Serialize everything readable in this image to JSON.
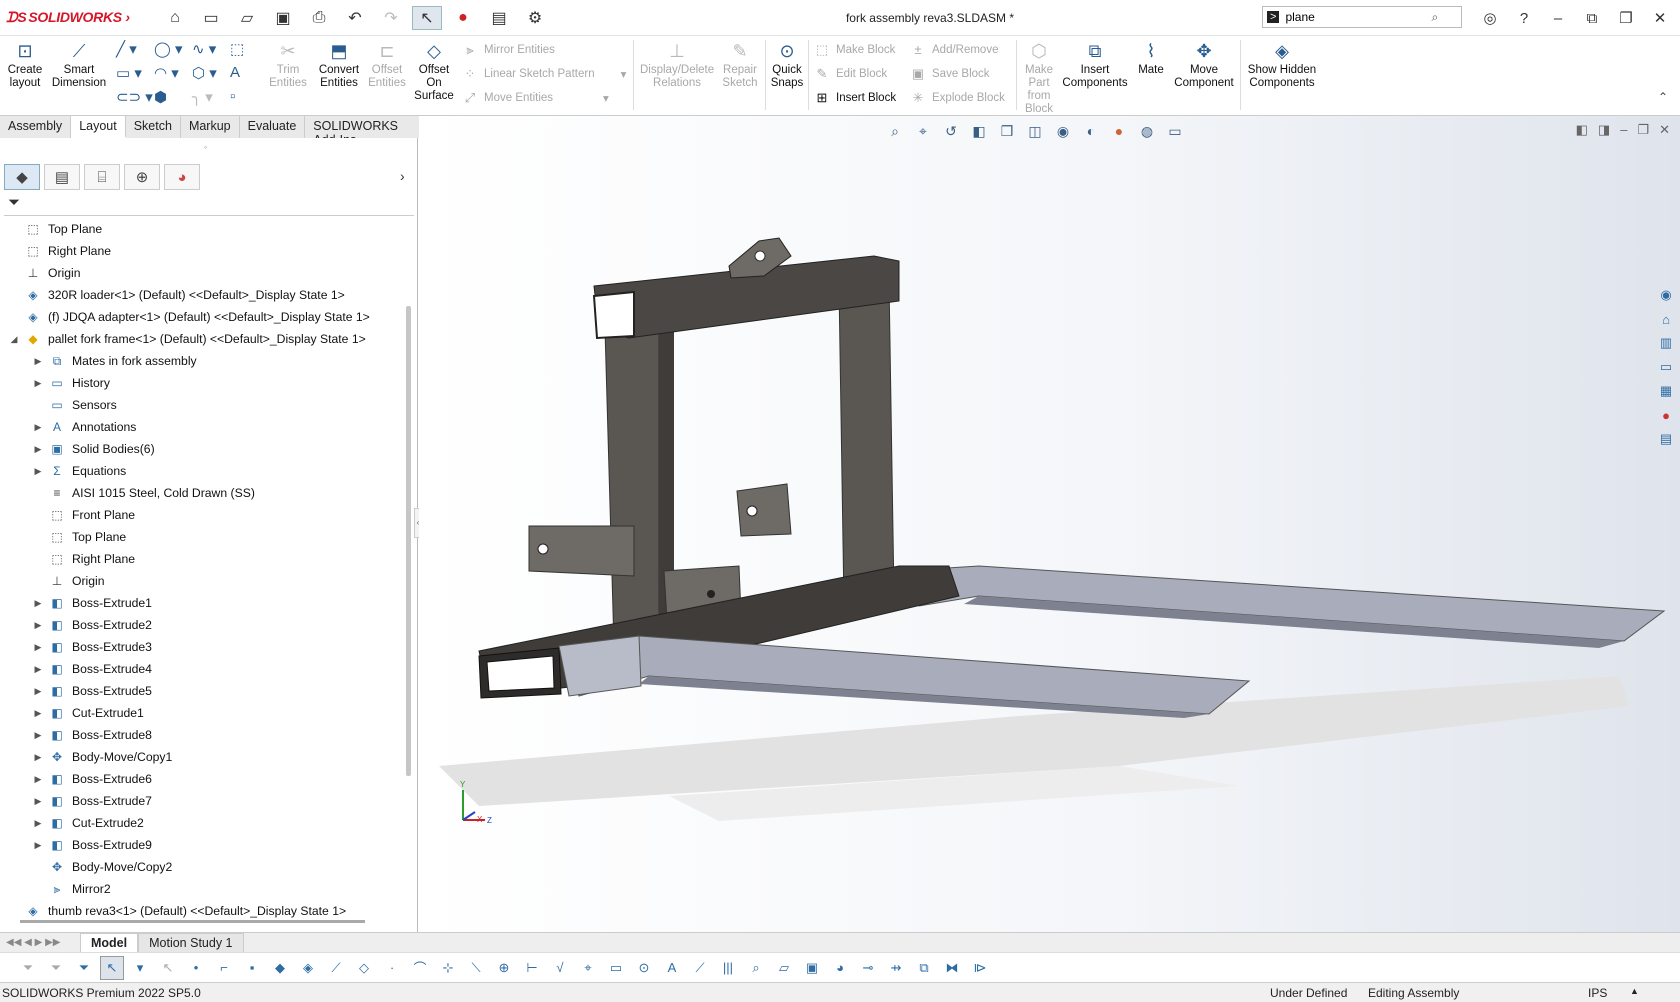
{
  "app": {
    "logo": "SOLIDWORKS",
    "document_title": "fork assembly reva3.SLDASM *"
  },
  "search": {
    "value": "plane"
  },
  "ribbon": {
    "create_layout": "Create layout",
    "smart_dimension": "Smart Dimension",
    "trim_entities": "Trim Entities",
    "convert_entities": "Convert Entities",
    "offset_entities": "Offset Entities",
    "offset_on_surface": "Offset On Surface",
    "mirror_entities": "Mirror Entities",
    "linear_sketch_pattern": "Linear Sketch Pattern",
    "move_entities": "Move Entities",
    "display_delete_relations": "Display/Delete Relations",
    "repair_sketch": "Repair Sketch",
    "quick_snaps": "Quick Snaps",
    "make_block": "Make Block",
    "edit_block": "Edit Block",
    "insert_block": "Insert Block",
    "add_remove": "Add/Remove",
    "save_block": "Save Block",
    "explode_block": "Explode Block",
    "make_part_from_block": "Make Part from Block",
    "insert_components": "Insert Components",
    "mate": "Mate",
    "move_component": "Move Component",
    "show_hidden_components": "Show Hidden Components"
  },
  "tabs": [
    "Assembly",
    "Layout",
    "Sketch",
    "Markup",
    "Evaluate",
    "SOLIDWORKS Add-Ins"
  ],
  "tree": [
    {
      "label": "Top Plane",
      "icon": "plane-icon",
      "level": 0,
      "arrow": ""
    },
    {
      "label": "Right Plane",
      "icon": "plane-icon",
      "level": 0,
      "arrow": ""
    },
    {
      "label": "Origin",
      "icon": "origin-icon",
      "level": 0,
      "arrow": ""
    },
    {
      "label": "320R loader<1> (Default) <<Default>_Display State 1>",
      "icon": "part-icon",
      "level": 0,
      "arrow": ""
    },
    {
      "label": "(f) JDQA adapter<1> (Default) <<Default>_Display State 1>",
      "icon": "part-icon",
      "level": 0,
      "arrow": ""
    },
    {
      "label": "pallet fork frame<1> (Default) <<Default>_Display State 1>",
      "icon": "part-yellow-icon",
      "level": 0,
      "arrow": "open"
    },
    {
      "label": "Mates in fork assembly",
      "icon": "mates-folder-icon",
      "level": 1,
      "arrow": "closed"
    },
    {
      "label": "History",
      "icon": "history-folder-icon",
      "level": 1,
      "arrow": "closed"
    },
    {
      "label": "Sensors",
      "icon": "sensors-folder-icon",
      "level": 1,
      "arrow": ""
    },
    {
      "label": "Annotations",
      "icon": "annotations-icon",
      "level": 1,
      "arrow": "closed"
    },
    {
      "label": "Solid Bodies(6)",
      "icon": "solid-bodies-icon",
      "level": 1,
      "arrow": "closed"
    },
    {
      "label": "Equations",
      "icon": "equations-icon",
      "level": 1,
      "arrow": "closed"
    },
    {
      "label": "AISI 1015 Steel, Cold Drawn (SS)",
      "icon": "material-icon",
      "level": 1,
      "arrow": ""
    },
    {
      "label": "Front Plane",
      "icon": "plane-icon",
      "level": 1,
      "arrow": ""
    },
    {
      "label": "Top Plane",
      "icon": "plane-icon",
      "level": 1,
      "arrow": ""
    },
    {
      "label": "Right Plane",
      "icon": "plane-icon",
      "level": 1,
      "arrow": ""
    },
    {
      "label": "Origin",
      "icon": "origin-icon",
      "level": 1,
      "arrow": ""
    },
    {
      "label": "Boss-Extrude1",
      "icon": "extrude-icon",
      "level": 1,
      "arrow": "closed"
    },
    {
      "label": "Boss-Extrude2",
      "icon": "extrude-icon",
      "level": 1,
      "arrow": "closed"
    },
    {
      "label": "Boss-Extrude3",
      "icon": "extrude-icon",
      "level": 1,
      "arrow": "closed"
    },
    {
      "label": "Boss-Extrude4",
      "icon": "extrude-icon",
      "level": 1,
      "arrow": "closed"
    },
    {
      "label": "Boss-Extrude5",
      "icon": "extrude-icon",
      "level": 1,
      "arrow": "closed"
    },
    {
      "label": "Cut-Extrude1",
      "icon": "extrude-icon",
      "level": 1,
      "arrow": "closed"
    },
    {
      "label": "Boss-Extrude8",
      "icon": "extrude-icon",
      "level": 1,
      "arrow": "closed"
    },
    {
      "label": "Body-Move/Copy1",
      "icon": "move-copy-icon",
      "level": 1,
      "arrow": "closed"
    },
    {
      "label": "Boss-Extrude6",
      "icon": "extrude-icon",
      "level": 1,
      "arrow": "closed"
    },
    {
      "label": "Boss-Extrude7",
      "icon": "extrude-icon",
      "level": 1,
      "arrow": "closed"
    },
    {
      "label": "Cut-Extrude2",
      "icon": "extrude-icon",
      "level": 1,
      "arrow": "closed"
    },
    {
      "label": "Boss-Extrude9",
      "icon": "extrude-icon",
      "level": 1,
      "arrow": "closed"
    },
    {
      "label": "Body-Move/Copy2",
      "icon": "move-copy-icon",
      "level": 1,
      "arrow": ""
    },
    {
      "label": "Mirror2",
      "icon": "mirror-icon",
      "level": 1,
      "arrow": ""
    },
    {
      "label": "thumb reva3<1> (Default) <<Default>_Display State 1>",
      "icon": "part-icon",
      "level": 0,
      "arrow": ""
    }
  ],
  "bottom_tabs": [
    "Model",
    "Motion Study 1"
  ],
  "status": {
    "product": "SOLIDWORKS Premium 2022 SP5.0",
    "definition": "Under Defined",
    "mode": "Editing Assembly",
    "units": "IPS"
  },
  "colors": {
    "accent": "#2e6da4",
    "brand_red": "#d6172a",
    "frame_dark": "#4a4744",
    "fork_steel": "#a9adbb"
  }
}
